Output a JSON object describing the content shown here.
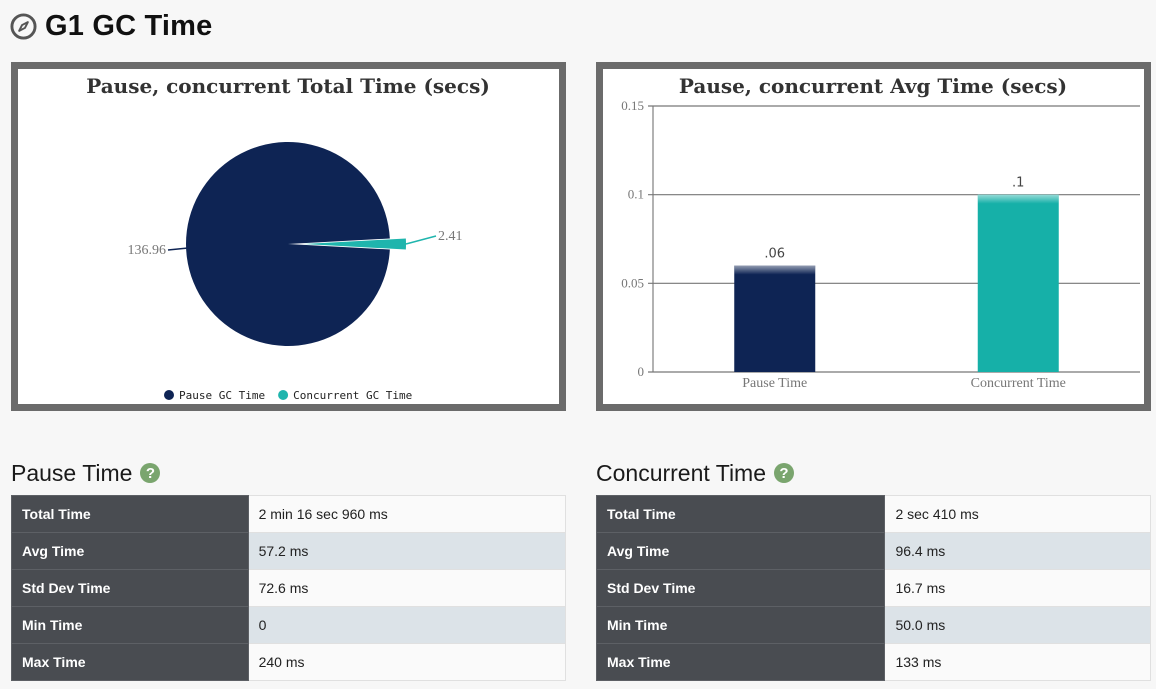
{
  "header": {
    "title": "G1 GC Time",
    "icon": "compass-icon"
  },
  "pie_chart": {
    "title": "Pause, concurrent Total Time (secs)",
    "legend": [
      "Pause GC Time",
      "Concurrent GC Time"
    ],
    "colors": [
      "#0e2454",
      "#1fb5ad"
    ]
  },
  "bar_chart": {
    "title": "Pause, concurrent Avg Time (secs)",
    "y_ticks": [
      "0",
      "0.05",
      "0.1",
      "0.15"
    ],
    "colors": [
      "#0e2454",
      "#16b0a8"
    ]
  },
  "chart_data": [
    {
      "type": "pie",
      "title": "Pause, concurrent Total Time (secs)",
      "categories": [
        "Pause GC Time",
        "Concurrent GC Time"
      ],
      "values": [
        136.96,
        2.41
      ],
      "labels": [
        "136.96",
        "2.41"
      ],
      "legend_position": "bottom"
    },
    {
      "type": "bar",
      "title": "Pause, concurrent Avg Time (secs)",
      "categories": [
        "Pause Time",
        "Concurrent Time"
      ],
      "values": [
        0.06,
        0.1
      ],
      "labels": [
        ".06",
        ".1"
      ],
      "ylim": [
        0,
        0.15
      ],
      "grid": true
    }
  ],
  "pause_section": {
    "title": "Pause Time",
    "rows": [
      {
        "label": "Total Time",
        "value": "2 min 16 sec 960 ms"
      },
      {
        "label": "Avg Time",
        "value": "57.2 ms"
      },
      {
        "label": "Std Dev Time",
        "value": "72.6 ms"
      },
      {
        "label": "Min Time",
        "value": "0"
      },
      {
        "label": "Max Time",
        "value": "240 ms"
      }
    ]
  },
  "concurrent_section": {
    "title": "Concurrent Time",
    "rows": [
      {
        "label": "Total Time",
        "value": "2 sec 410 ms"
      },
      {
        "label": "Avg Time",
        "value": "96.4 ms"
      },
      {
        "label": "Std Dev Time",
        "value": "16.7 ms"
      },
      {
        "label": "Min Time",
        "value": "50.0 ms"
      },
      {
        "label": "Max Time",
        "value": "133 ms"
      }
    ]
  }
}
